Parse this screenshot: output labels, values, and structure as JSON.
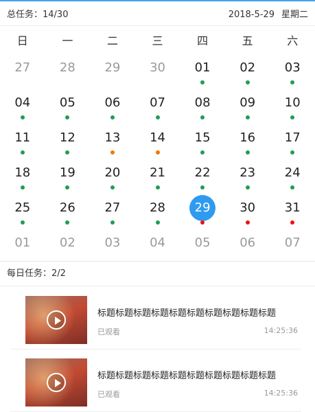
{
  "header": {
    "total_label": "总任务：14/30",
    "date": "2018-5-29",
    "weekday": "星期二"
  },
  "weekdays": [
    "日",
    "一",
    "二",
    "三",
    "四",
    "五",
    "六"
  ],
  "colors": {
    "green": "#1f9d55",
    "orange": "#f07800",
    "red": "#ee1111",
    "today": "#2f9bf0"
  },
  "calendar": [
    [
      {
        "d": "27",
        "other": true
      },
      {
        "d": "28",
        "other": true
      },
      {
        "d": "29",
        "other": true
      },
      {
        "d": "30",
        "other": true
      },
      {
        "d": "01",
        "dot": "green"
      },
      {
        "d": "02",
        "dot": "green"
      },
      {
        "d": "03",
        "dot": "green"
      }
    ],
    [
      {
        "d": "04",
        "dot": "green"
      },
      {
        "d": "05",
        "dot": "green"
      },
      {
        "d": "06",
        "dot": "green"
      },
      {
        "d": "07",
        "dot": "green"
      },
      {
        "d": "08",
        "dot": "green"
      },
      {
        "d": "09",
        "dot": "green"
      },
      {
        "d": "10",
        "dot": "green"
      }
    ],
    [
      {
        "d": "11",
        "dot": "green"
      },
      {
        "d": "12",
        "dot": "green"
      },
      {
        "d": "13",
        "dot": "orange"
      },
      {
        "d": "14",
        "dot": "orange"
      },
      {
        "d": "15",
        "dot": "green"
      },
      {
        "d": "16",
        "dot": "green"
      },
      {
        "d": "17",
        "dot": "green"
      }
    ],
    [
      {
        "d": "18",
        "dot": "green"
      },
      {
        "d": "19",
        "dot": "green"
      },
      {
        "d": "20",
        "dot": "green"
      },
      {
        "d": "21",
        "dot": "green"
      },
      {
        "d": "22",
        "dot": "green"
      },
      {
        "d": "23",
        "dot": "green"
      },
      {
        "d": "24",
        "dot": "green"
      }
    ],
    [
      {
        "d": "25",
        "dot": "green"
      },
      {
        "d": "26",
        "dot": "green"
      },
      {
        "d": "27",
        "dot": "green"
      },
      {
        "d": "28",
        "dot": "green"
      },
      {
        "d": "29",
        "dot": "red",
        "today": true
      },
      {
        "d": "30",
        "dot": "red"
      },
      {
        "d": "31",
        "dot": "red"
      }
    ],
    [
      {
        "d": "01",
        "other": true
      },
      {
        "d": "02",
        "other": true
      },
      {
        "d": "03",
        "other": true
      },
      {
        "d": "04",
        "other": true
      },
      {
        "d": "05",
        "other": true
      },
      {
        "d": "06",
        "other": true
      },
      {
        "d": "07",
        "other": true
      }
    ]
  ],
  "daily": {
    "label": "每日任务：2/2"
  },
  "tasks": [
    {
      "title": "标题标题标题标题标题标题标题标题标题标题",
      "status": "已观看",
      "time": "14:25:36"
    },
    {
      "title": "标题标题标题标题标题标题标题标题标题标题",
      "status": "已观看",
      "time": "14:25:36"
    }
  ]
}
